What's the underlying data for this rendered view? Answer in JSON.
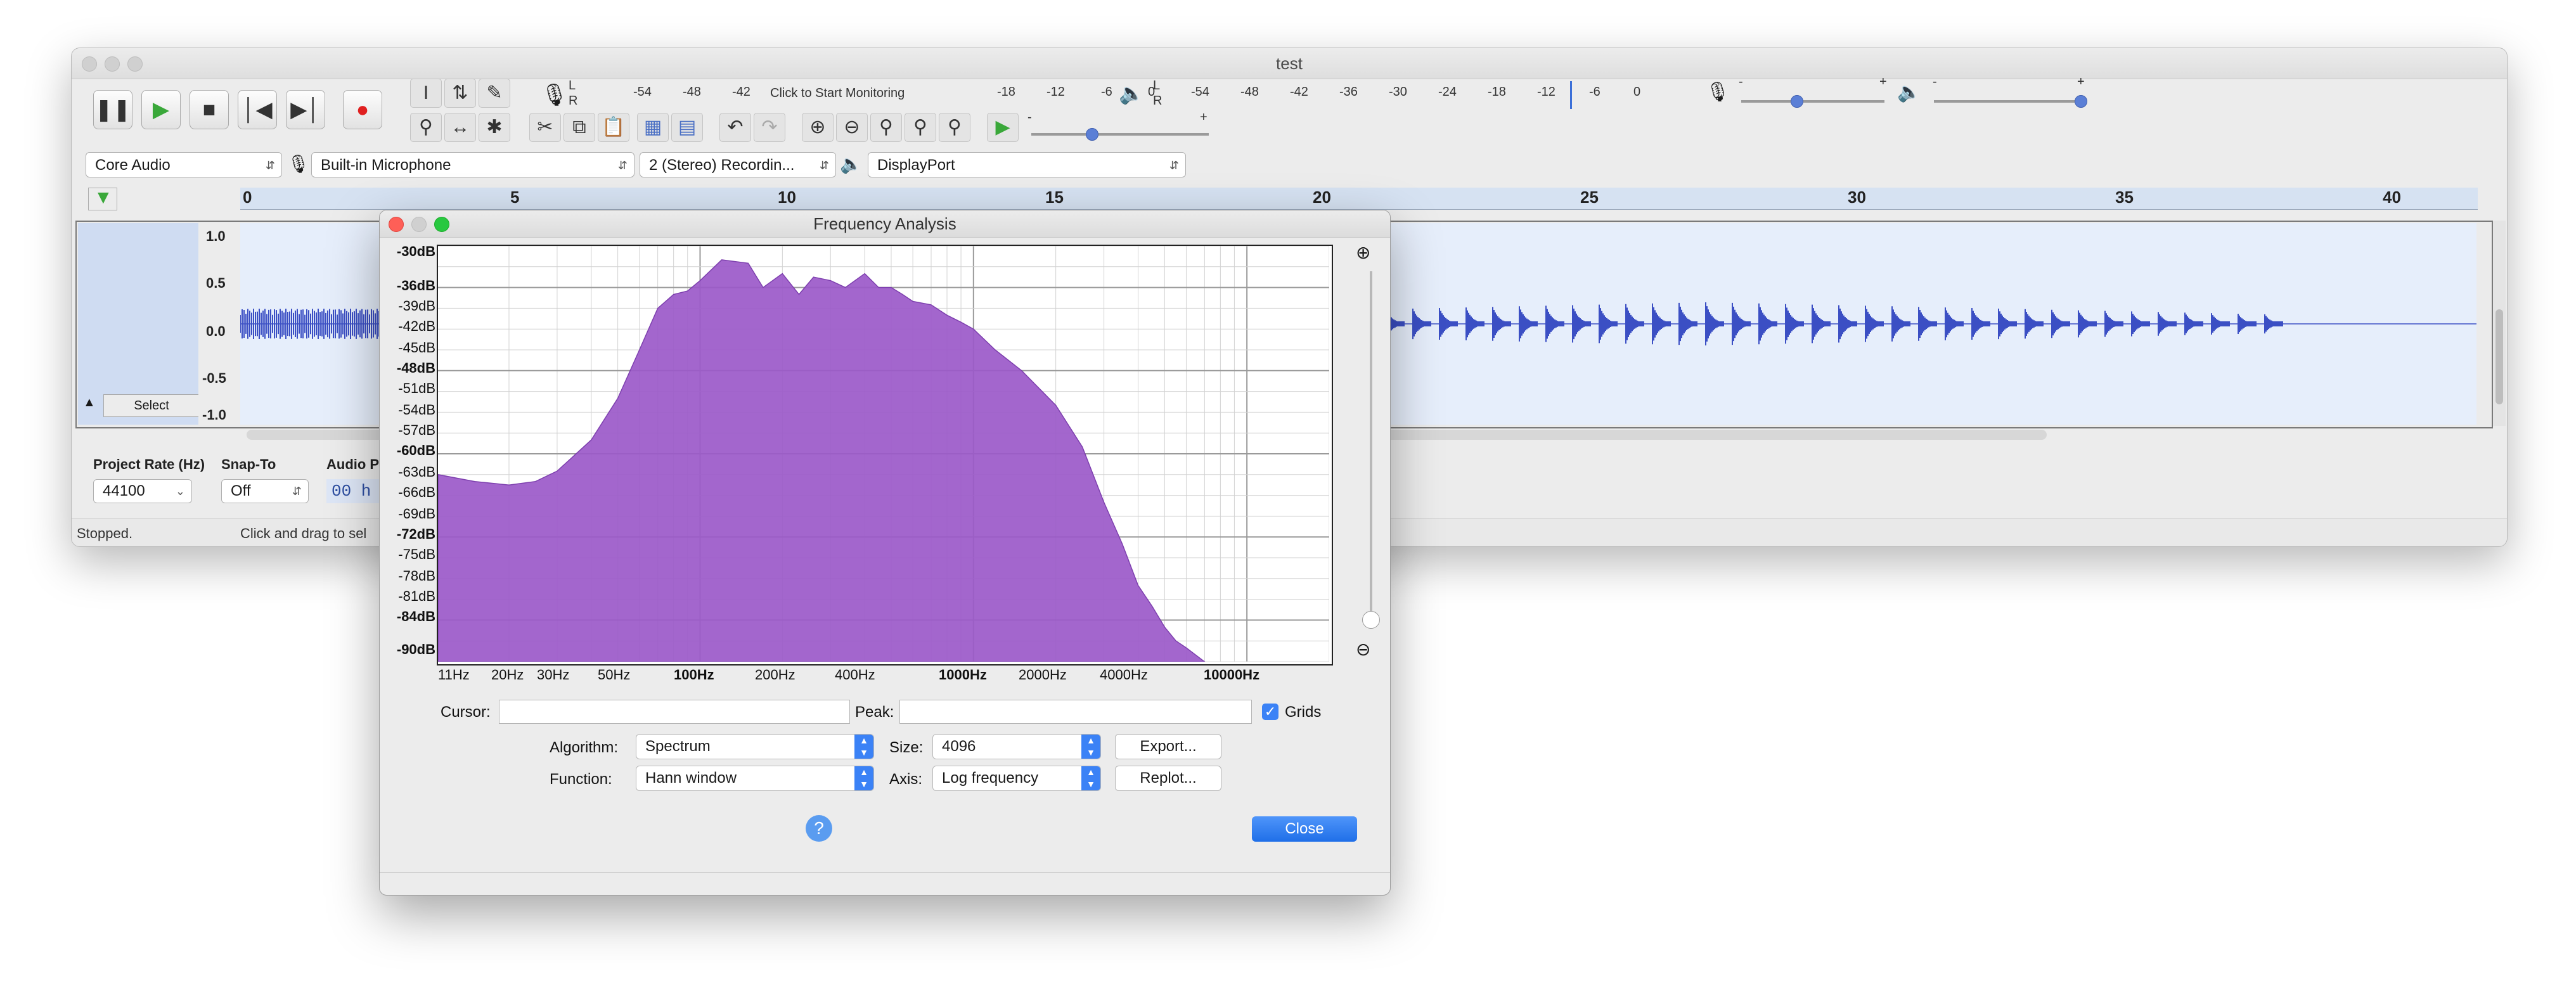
{
  "window": {
    "title": "test"
  },
  "toolbar": {
    "monitor_label": "Click to Start Monitoring",
    "rec_meter_ticks": [
      "-54",
      "-48",
      "-42",
      "-18",
      "-12",
      "-6",
      "0"
    ],
    "play_meter_ticks": [
      "-54",
      "-48",
      "-42",
      "-36",
      "-30",
      "-24",
      "-18",
      "-12",
      "-6",
      "0"
    ],
    "meter_lr": [
      "L",
      "R"
    ],
    "slider_minus": "-",
    "slider_plus": "+"
  },
  "devices": {
    "host": "Core Audio",
    "recording_device": "Built-in Microphone",
    "channels": "2 (Stereo) Recordin...",
    "playback_device": "DisplayPort"
  },
  "timeline": {
    "ticks": [
      "0",
      "5",
      "10",
      "15",
      "20",
      "25",
      "30",
      "35",
      "40"
    ]
  },
  "track": {
    "amplitude_labels": [
      "1.0",
      "0.5",
      "0.0",
      "-0.5",
      "-1.0"
    ],
    "select_label": "Select"
  },
  "selection_bar": {
    "project_rate_label": "Project Rate (Hz)",
    "project_rate_value": "44100",
    "snap_to_label": "Snap-To",
    "snap_to_value": "Off",
    "audio_pos_label": "Audio P",
    "audio_pos_value": "00 h 0"
  },
  "status": {
    "state": "Stopped.",
    "hint": "Click and drag to sel"
  },
  "dialog": {
    "title": "Frequency Analysis",
    "db_labels": [
      "-30dB",
      "-36dB",
      "-39dB",
      "-42dB",
      "-45dB",
      "-48dB",
      "-51dB",
      "-54dB",
      "-57dB",
      "-60dB",
      "-63dB",
      "-66dB",
      "-69dB",
      "-72dB",
      "-75dB",
      "-78dB",
      "-81dB",
      "-84dB",
      "-90dB"
    ],
    "hz_labels": [
      "11Hz",
      "20Hz",
      "30Hz",
      "50Hz",
      "100Hz",
      "200Hz",
      "400Hz",
      "1000Hz",
      "2000Hz",
      "4000Hz",
      "10000Hz"
    ],
    "cursor_label": "Cursor:",
    "peak_label": "Peak:",
    "grids_label": "Grids",
    "grids_checked": true,
    "algorithm_label": "Algorithm:",
    "algorithm_value": "Spectrum",
    "function_label": "Function:",
    "function_value": "Hann window",
    "size_label": "Size:",
    "size_value": "4096",
    "axis_label": "Axis:",
    "axis_value": "Log frequency",
    "export_label": "Export...",
    "replot_label": "Replot...",
    "close_label": "Close",
    "help_glyph": "?"
  },
  "colors": {
    "spectrum_fill": "#9b59c9",
    "waveform": "#3b4fc4",
    "accent": "#2f7bf0"
  },
  "chart_data": {
    "type": "area",
    "x_scale": "log",
    "xlim": [
      11,
      20000
    ],
    "ylim": [
      -90,
      -30
    ],
    "grid": true,
    "x": [
      11,
      15,
      20,
      25,
      30,
      40,
      50,
      60,
      70,
      80,
      90,
      100,
      120,
      150,
      170,
      200,
      230,
      260,
      300,
      340,
      400,
      450,
      500,
      550,
      600,
      700,
      800,
      900,
      1000,
      1200,
      1500,
      2000,
      2500,
      3000,
      3500,
      4000,
      4500,
      5000,
      5500,
      6000,
      7000
    ],
    "y": [
      -63,
      -64,
      -64.5,
      -64,
      -62.5,
      -58,
      -52,
      -45,
      -39,
      -37,
      -36.5,
      -35,
      -32,
      -32.5,
      -36,
      -34,
      -37,
      -34.5,
      -35,
      -36,
      -34,
      -36,
      -36,
      -37,
      -38,
      -38.5,
      -40,
      -41,
      -42,
      -45,
      -48,
      -53,
      -59,
      -67,
      -73,
      -79,
      -82,
      -85,
      -87,
      -88,
      -90
    ]
  }
}
